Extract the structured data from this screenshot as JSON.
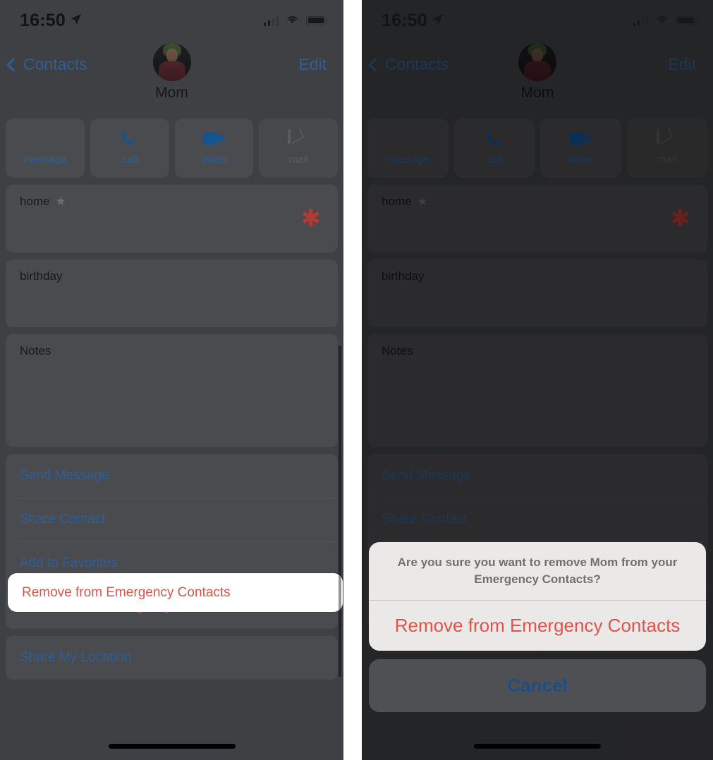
{
  "status_bar": {
    "time": "16:50",
    "location_icon": "location-arrow-icon",
    "signal_icon": "cellular-signal-icon",
    "wifi_icon": "wifi-icon",
    "battery_icon": "battery-icon"
  },
  "nav": {
    "back_label": "Contacts",
    "edit_label": "Edit",
    "back_icon": "chevron-left-icon"
  },
  "contact": {
    "name": "Mom",
    "avatar_icon": "contact-photo"
  },
  "quick_actions": [
    {
      "label": "message",
      "icon": "message-bubble-icon",
      "disabled": false
    },
    {
      "label": "call",
      "icon": "phone-handset-icon",
      "disabled": false
    },
    {
      "label": "video",
      "icon": "video-camera-icon",
      "disabled": false
    },
    {
      "label": "mail",
      "icon": "mail-envelope-icon",
      "disabled": true
    }
  ],
  "fields": {
    "phone_label": "home",
    "phone_star_icon": "star-icon",
    "phone_value": "✱",
    "birthday_label": "birthday",
    "notes_label": "Notes"
  },
  "links": {
    "send_message": "Send Message",
    "share_contact": "Share Contact",
    "add_to_favorites": "Add to Favorites",
    "remove_emergency": "Remove from Emergency Contacts",
    "share_my_location": "Share My Location"
  },
  "action_sheet": {
    "title": "Are you sure you want to remove Mom from your Emergency Contacts?",
    "destructive_label": "Remove from Emergency Contacts",
    "cancel_label": "Cancel"
  },
  "colors": {
    "accent_blue": "#2d5f96",
    "destructive_red": "#d6564f",
    "sheet_red": "#e2524c",
    "cancel_blue": "#1c4f8a",
    "panel_bg": "#3f4044",
    "card_bg": "#4a4b4f",
    "highlight_white": "#ffffff",
    "redacted_red": "#b23a35"
  }
}
